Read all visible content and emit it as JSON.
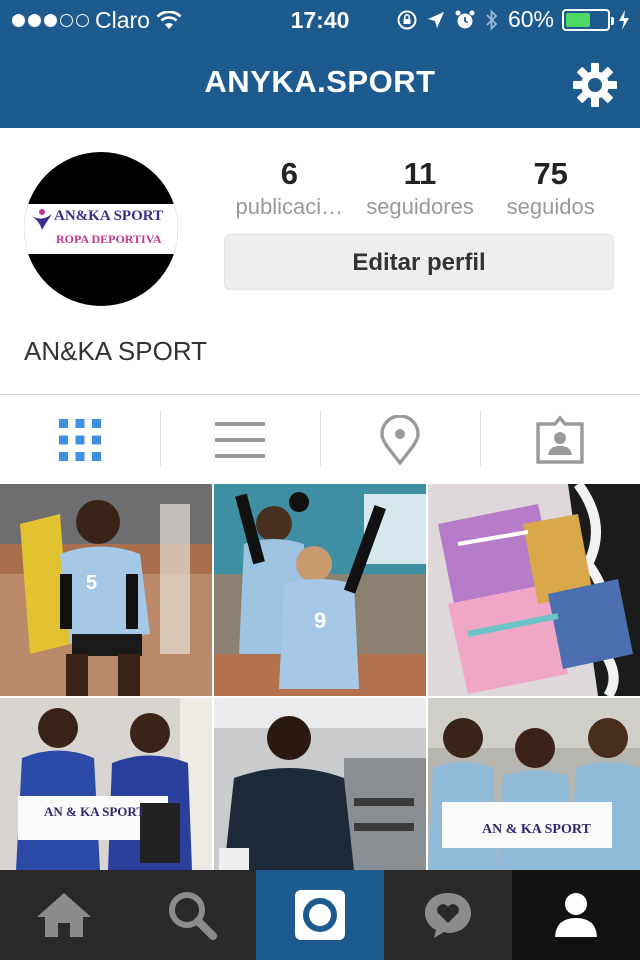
{
  "status_bar": {
    "carrier": "Claro",
    "time": "17:40",
    "battery_percent": "60%",
    "battery_level": 0.6,
    "signal_bars_filled": 3,
    "signal_bars_total": 5
  },
  "header": {
    "title": "ANYKA.SPORT",
    "settings_icon": "gear-icon"
  },
  "profile": {
    "avatar_logo": {
      "line1": "AN&KA SPORT",
      "line2": "ROPA DEPORTIVA"
    },
    "stats": [
      {
        "value": "6",
        "label": "publicaci…"
      },
      {
        "value": "11",
        "label": "seguidores"
      },
      {
        "value": "75",
        "label": "seguidos"
      }
    ],
    "edit_button": "Editar perfil",
    "display_name": "AN&KA SPORT"
  },
  "view_tabs": [
    {
      "icon": "grid-icon",
      "active": true
    },
    {
      "icon": "list-icon",
      "active": false
    },
    {
      "icon": "location-pin-icon",
      "active": false
    },
    {
      "icon": "tagged-photos-icon",
      "active": false
    }
  ],
  "photos": {
    "banner_1": "AN & KA SPORT",
    "banner_2": "AN & KA SPORT",
    "jersey_1": "5",
    "jersey_2": "9"
  },
  "bottom_nav": [
    {
      "icon": "home-icon"
    },
    {
      "icon": "search-icon"
    },
    {
      "icon": "camera-icon",
      "active": true
    },
    {
      "icon": "activity-heart-icon"
    },
    {
      "icon": "profile-icon"
    }
  ],
  "colors": {
    "brand_blue": "#1d5a8e",
    "active_tab": "#3f8fe0",
    "battery_green": "#4cd964"
  }
}
